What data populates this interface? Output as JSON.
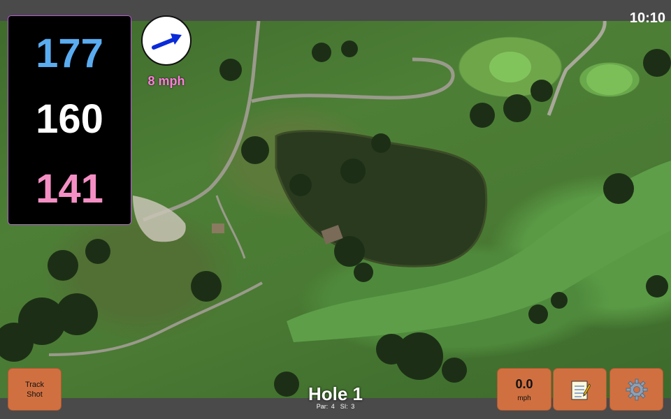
{
  "status": {
    "time": "10:10"
  },
  "yardages": {
    "back": "177",
    "center": "160",
    "front": "141"
  },
  "wind": {
    "speed": "8 mph",
    "icon": "wind-direction-arrow-icon",
    "color": "#ff7fdc"
  },
  "hole": {
    "title": "Hole 1",
    "par": "Par: 4",
    "si": "SI: 3"
  },
  "buttons": {
    "track_shot": "Track\nShot",
    "speed_value": "0.0",
    "speed_unit": "mph",
    "notes_icon": "notepad-icon",
    "settings_icon": "gear-icon"
  },
  "colors": {
    "back_yardage": "#5aacf0",
    "center_yardage": "#ffffff",
    "front_yardage": "#f48fc4",
    "button_bg": "#d07040",
    "bar_bg": "#4a4a4a"
  }
}
